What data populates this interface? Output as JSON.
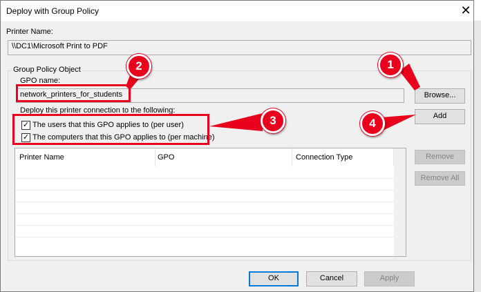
{
  "window": {
    "title": "Deploy with Group Policy",
    "close_glyph": "✕"
  },
  "printer": {
    "label": "Printer Name:",
    "value": "\\\\DC1\\Microsoft Print to PDF"
  },
  "group": {
    "legend": "Group Policy Object",
    "gpo_label": "GPO name:",
    "gpo_value": "network_printers_for_students",
    "browse_label": "Browse...",
    "deploy_label": "Deploy this printer connection to the following:",
    "add_label": "Add",
    "checkboxes": [
      {
        "label": "The users that this GPO applies to (per user)",
        "checked": true
      },
      {
        "label": "The computers that this GPO applies to (per machine)",
        "checked": true
      }
    ],
    "table": {
      "columns": [
        "Printer Name",
        "GPO",
        "Connection Type"
      ],
      "rows": []
    },
    "remove_label": "Remove",
    "remove_all_label": "Remove All"
  },
  "footer": {
    "ok_label": "OK",
    "cancel_label": "Cancel",
    "apply_label": "Apply"
  },
  "annotations": {
    "color": "#e8001c",
    "badges": [
      "1",
      "2",
      "3",
      "4"
    ]
  }
}
